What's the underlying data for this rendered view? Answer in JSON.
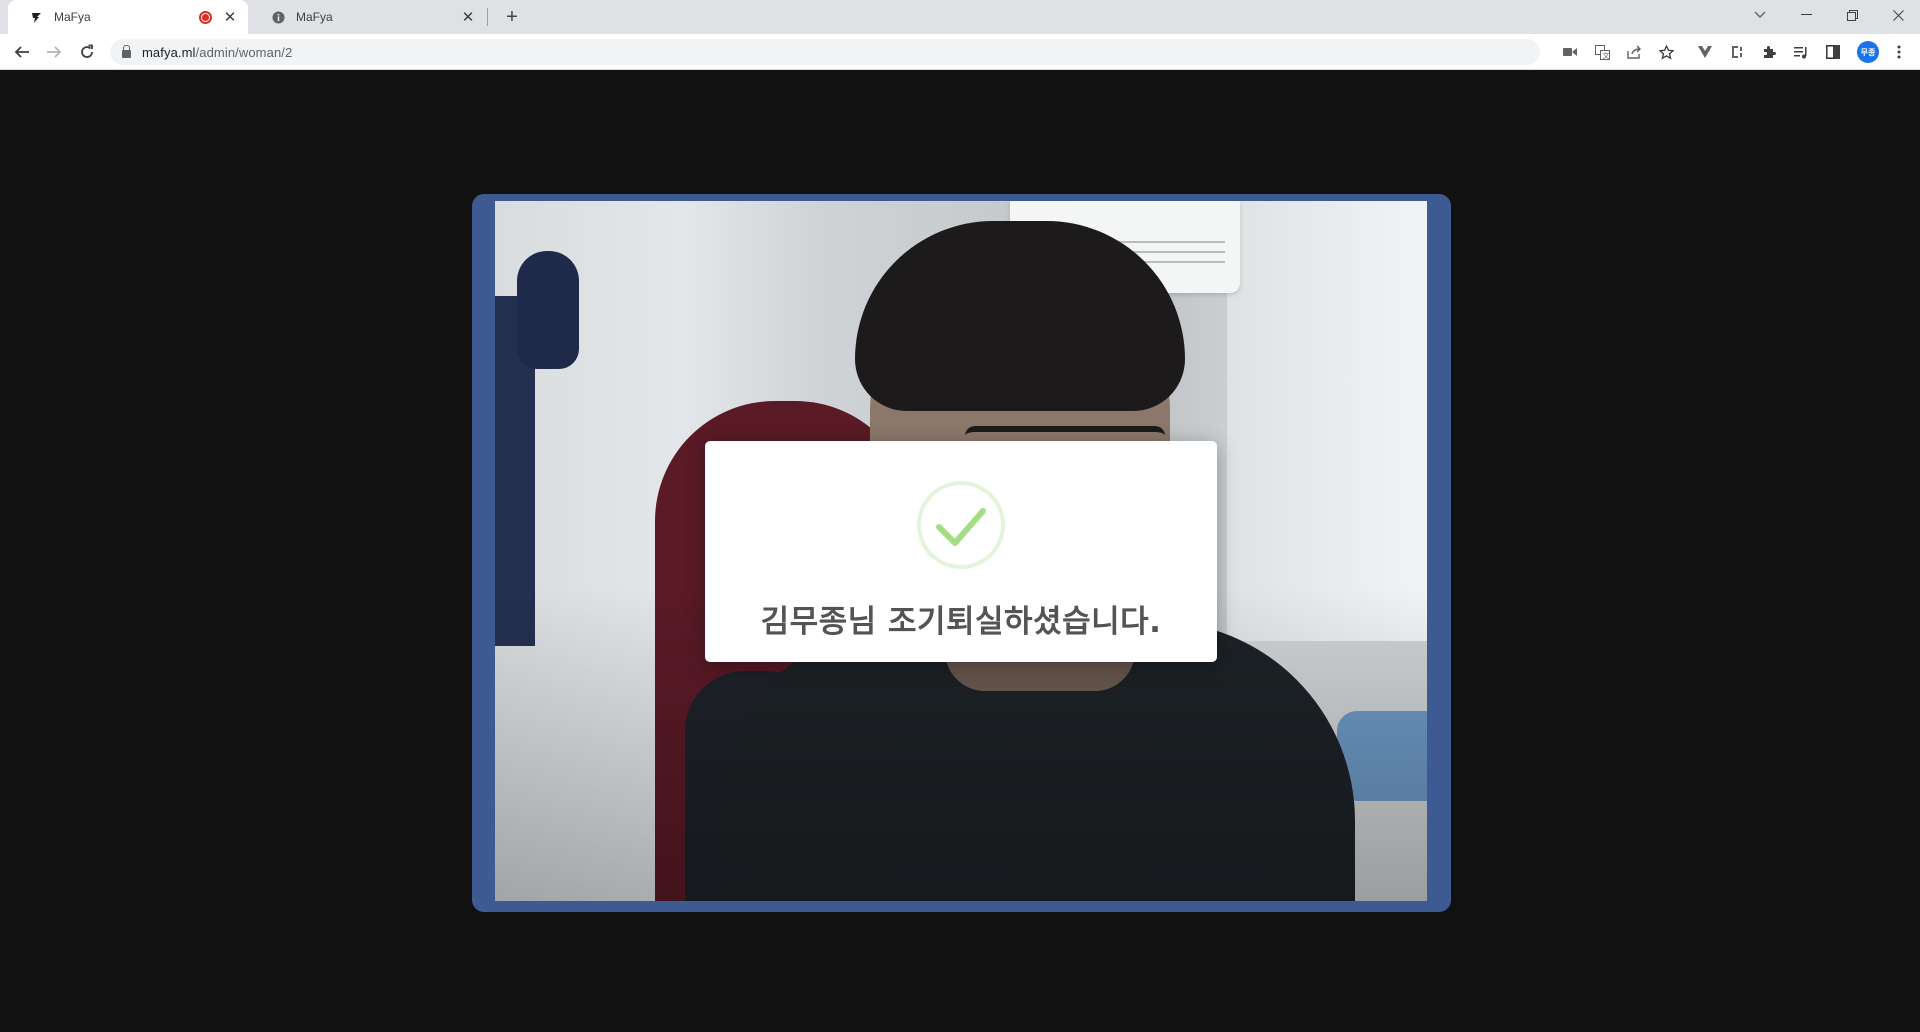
{
  "browser": {
    "tabs": [
      {
        "title": "MaFya",
        "active": true,
        "recording": true
      },
      {
        "title": "MaFya",
        "active": false,
        "recording": false
      }
    ],
    "url": {
      "host": "mafya.ml",
      "path": "/admin/woman/2"
    },
    "profile_initials": "무종"
  },
  "modal": {
    "icon": "success-check-icon",
    "message": "김무종님 조기퇴실하셨습니다."
  },
  "colors": {
    "page_background": "#111111",
    "video_frame": "#3d5a92",
    "check_green": "#a5dc86",
    "modal_text": "#545454"
  }
}
